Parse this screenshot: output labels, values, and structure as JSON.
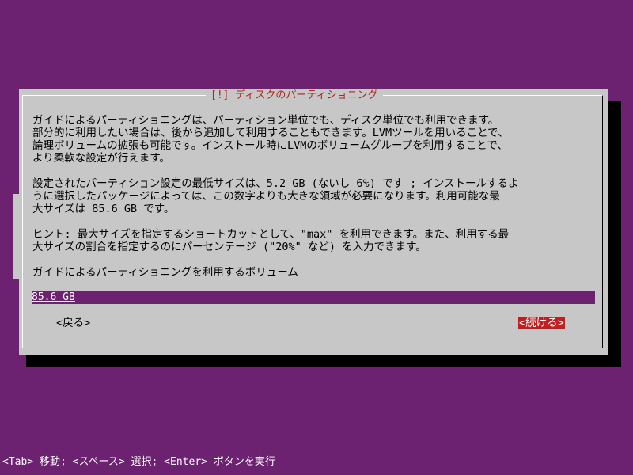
{
  "dialog": {
    "title": "[!] ディスクのパーティショニング",
    "paragraph1": "ガイドによるパーティショニングは、パーティション単位でも、ディスク単位でも利用できます。\n部分的に利用したい場合は、後から追加して利用することもできます。LVMツールを用いることで、\n論理ボリュームの拡張も可能です。インストール時にLVMのボリュームグループを利用することで、\nより柔軟な設定が行えます。",
    "paragraph2": "設定されたパーティション設定の最低サイズは、5.2 GB (ないし 6%) です ; インストールするよ\nうに選択したパッケージによっては、この数字よりも大きな領域が必要になります。利用可能な最\n大サイズは 85.6 GB です。",
    "paragraph3": "ヒント: 最大サイズを指定するショートカットとして、\"max\" を利用できます。また、利用する最\n大サイズの割合を指定するのにパーセンテージ (\"20%\" など) を入力できます。",
    "prompt": "ガイドによるパーティショニングを利用するボリューム",
    "size_value": "85.6 GB",
    "back_label": "<戻る>",
    "continue_label": "<続ける>"
  },
  "status_bar": {
    "text": "<Tab> 移動; <スペース> 選択; <Enter> ボタンを実行"
  },
  "colors": {
    "background": "#6c2171",
    "dialog": "#c7c7c7",
    "title_text": "#b3241e",
    "focused_button": "#c11f1f"
  }
}
